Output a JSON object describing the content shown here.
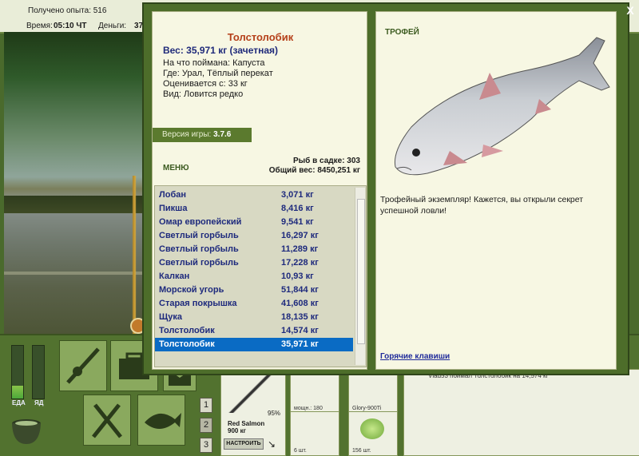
{
  "topbar": {
    "experience_label": "Получено опыта: 516",
    "time_label": "Время:",
    "time_value": "05:10 ЧТ",
    "money_label": "Деньги:",
    "money_value": "37"
  },
  "scene": {
    "watermark": ""
  },
  "bottom": {
    "gauge_food_label": "ЕДА",
    "gauge_food_level": 0.25,
    "gauge_poison_label": "ЯД",
    "gauge_poison_level": 0.0,
    "page_buttons": [
      "1",
      "2",
      "3"
    ],
    "tackle": {
      "percent": "95%",
      "name": "Red Salmon",
      "weight": "900 кг",
      "setup_button": "НАСТРОИТЬ"
    },
    "slots": [
      {
        "caption": "мощн.: 180"
      },
      {
        "caption": "Glory-900Ti"
      },
      {
        "caption": "6 шт."
      },
      {
        "caption": "156 шт."
      }
    ],
    "chat_message": "Vlad53 поймал Толстолобик на 14,574 кг"
  },
  "dialog": {
    "close_label": "X",
    "fish_title": "Толстолобик",
    "weight": "Вес: 35,971 кг (зачетная)",
    "caught_on": "На что поймана: Капуста",
    "where": "Где: Урал, Тёплый перекат",
    "valued_from": "Оценивается с: 33 кг",
    "kind": "Вид: Ловится редко",
    "version_label": "Версия игры:",
    "version_value": "3.7.6",
    "menu_label": "МЕНЮ",
    "keep_count": "Рыб в садке: 303",
    "keep_weight": "Общий вес: 8450,251 кг",
    "list": [
      {
        "name": "Лобан",
        "weight": "3,071 кг"
      },
      {
        "name": "Пикша",
        "weight": "8,416 кг"
      },
      {
        "name": "Омар европейский",
        "weight": "9,541 кг"
      },
      {
        "name": "Светлый горбыль",
        "weight": "16,297 кг"
      },
      {
        "name": "Светлый горбыль",
        "weight": "11,289 кг"
      },
      {
        "name": "Светлый горбыль",
        "weight": "17,228 кг"
      },
      {
        "name": "Калкан",
        "weight": "10,93 кг"
      },
      {
        "name": "Морской угорь",
        "weight": "51,844 кг"
      },
      {
        "name": "Старая покрышка",
        "weight": "41,608 кг"
      },
      {
        "name": "Щука",
        "weight": "18,135 кг"
      },
      {
        "name": "Толстолобик",
        "weight": "14,574 кг"
      },
      {
        "name": "Толстолобик",
        "weight": "35,971 кг",
        "selected": true
      }
    ],
    "trophy_label": "ТРОФЕЙ",
    "description": "Трофейный экземпляр! Кажется, вы открыли секрет успешной ловли!",
    "hotkeys_label": "Горячие клавиши"
  }
}
